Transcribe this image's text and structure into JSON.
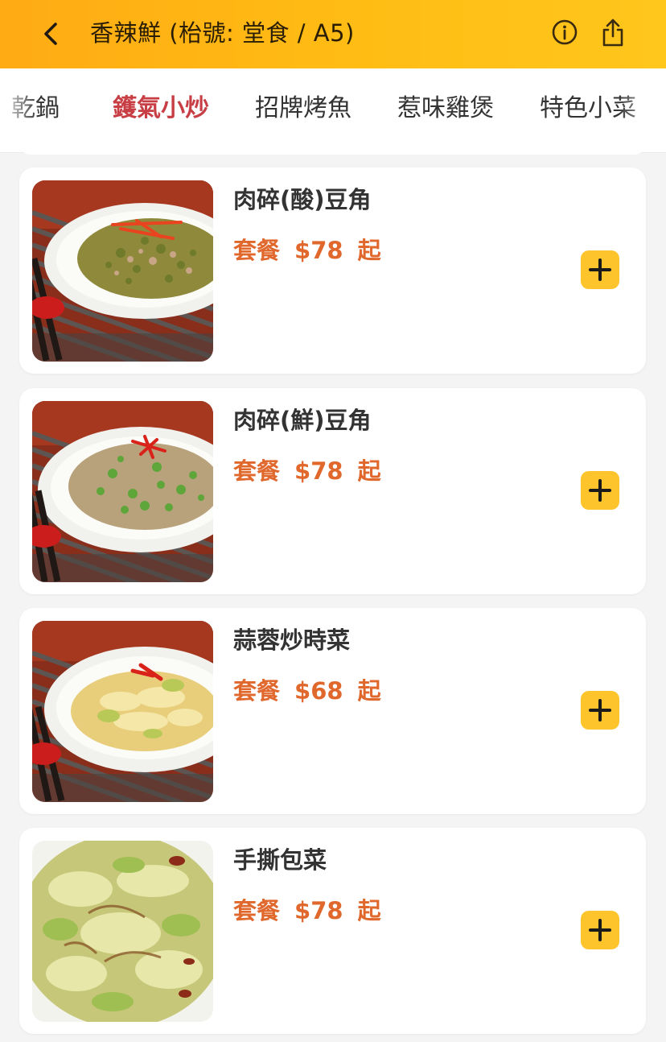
{
  "header": {
    "title": "香辣鮮 (枱號: 堂食 / A5)",
    "back_icon": "chevron-left-icon",
    "info_icon": "info-circle-icon",
    "share_icon": "share-icon",
    "gradient_start": "#ffab14",
    "gradient_end": "#ffc61c"
  },
  "tabs": [
    {
      "label": "乾鍋"
    },
    {
      "label": "鑊氣小炒",
      "active": true
    },
    {
      "label": "招牌烤魚"
    },
    {
      "label": "惹味雞煲"
    },
    {
      "label": "特色小菜"
    }
  ],
  "accent_color": "#c73f45",
  "price_color": "#e0682c",
  "add_button_color": "#fdc52b",
  "dishes": [
    {
      "name": "肉碎(酸)豆角",
      "price_prefix": "套餐",
      "price": "$78",
      "price_suffix": "起",
      "image": "sour-long-beans-with-minced-pork"
    },
    {
      "name": "肉碎(鮮)豆角",
      "price_prefix": "套餐",
      "price": "$78",
      "price_suffix": "起",
      "image": "fresh-long-beans-with-minced-pork"
    },
    {
      "name": "蒜蓉炒時菜",
      "price_prefix": "套餐",
      "price": "$68",
      "price_suffix": "起",
      "image": "garlic-stir-fried-vegetables"
    },
    {
      "name": "手撕包菜",
      "price_prefix": "套餐",
      "price": "$78",
      "price_suffix": "起",
      "image": "hand-torn-cabbage"
    }
  ]
}
